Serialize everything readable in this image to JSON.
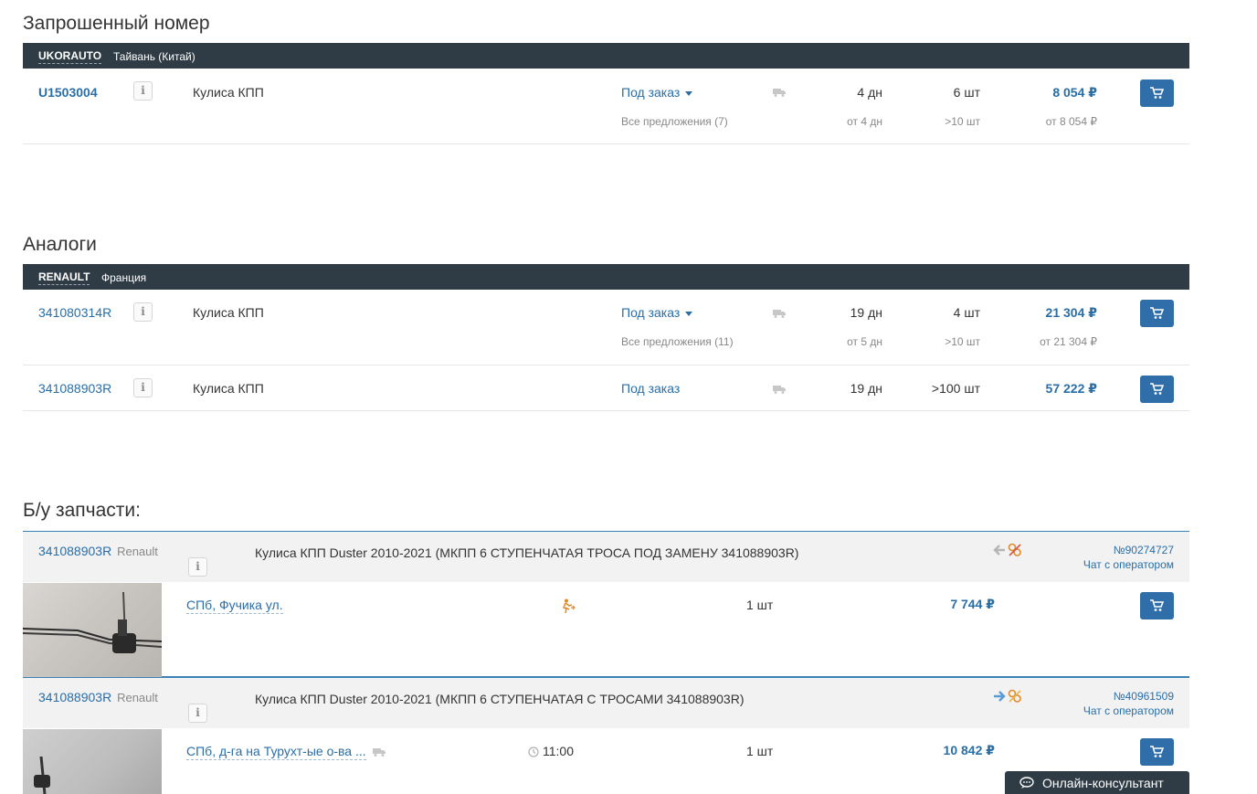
{
  "requested": {
    "title": "Запрошенный номер",
    "brand": "UKORAUTO",
    "country": "Тайвань (Китай)",
    "row": {
      "number": "U1503004",
      "info": "i",
      "name": "Кулиса КПП",
      "availability": "Под заказ",
      "offers": "Все предложения (7)",
      "days": "4 дн",
      "days_from": "от 4 дн",
      "qty": "6 шт",
      "qty_sub": ">10 шт",
      "price": "8 054 ₽",
      "price_from": "от 8 054 ₽"
    }
  },
  "analogs": {
    "title": "Аналоги",
    "brand": "RENAULT",
    "country": "Франция",
    "rows": [
      {
        "number": "341080314R",
        "info": "i",
        "name": "Кулиса КПП",
        "availability": "Под заказ",
        "offers": "Все предложения (11)",
        "days": "19 дн",
        "days_from": "от 5 дн",
        "qty": "4 шт",
        "qty_sub": ">10 шт",
        "price": "21 304 ₽",
        "price_from": "от 21 304 ₽"
      },
      {
        "number": "341088903R",
        "info": "i",
        "name": "Кулиса КПП",
        "availability": "Под заказ",
        "days": "19 дн",
        "qty": ">100 шт",
        "price": "57 222 ₽"
      }
    ]
  },
  "used": {
    "title": "Б/у запчасти:",
    "items": [
      {
        "number": "341088903R",
        "brand": "Renault",
        "info": "i",
        "description": "Кулиса КПП Duster 2010-2021 (МКПП 6 СТУПЕНЧАТАЯ ТРОСА ПОД ЗАМЕНУ 341088903R)",
        "order_no": "№90274727",
        "chat": "Чат с оператором",
        "location": "СПб, Фучика ул.",
        "qty": "1 шт",
        "price": "7 744 ₽",
        "arrow_color": "#b5b5b5"
      },
      {
        "number": "341088903R",
        "brand": "Renault",
        "info": "i",
        "description": "Кулиса КПП Duster 2010-2021 (МКПП 6 СТУПЕНЧАТАЯ С ТРОСАМИ 341088903R)",
        "order_no": "№40961509",
        "chat": "Чат с оператором",
        "location": "СПб, д-га на Турухт-ые о-ва ...",
        "time": "11:00",
        "qty": "1 шт",
        "price": "10 842 ₽",
        "arrow_color": "#5b9bd5"
      }
    ]
  },
  "consultant": {
    "label": "Онлайн-консультант"
  },
  "colors": {
    "bar": "#2f3c45",
    "link": "#2a6ea6",
    "cart": "#2f6ea8",
    "accent_line": "#3b82b6",
    "orange": "#e08a2a"
  }
}
